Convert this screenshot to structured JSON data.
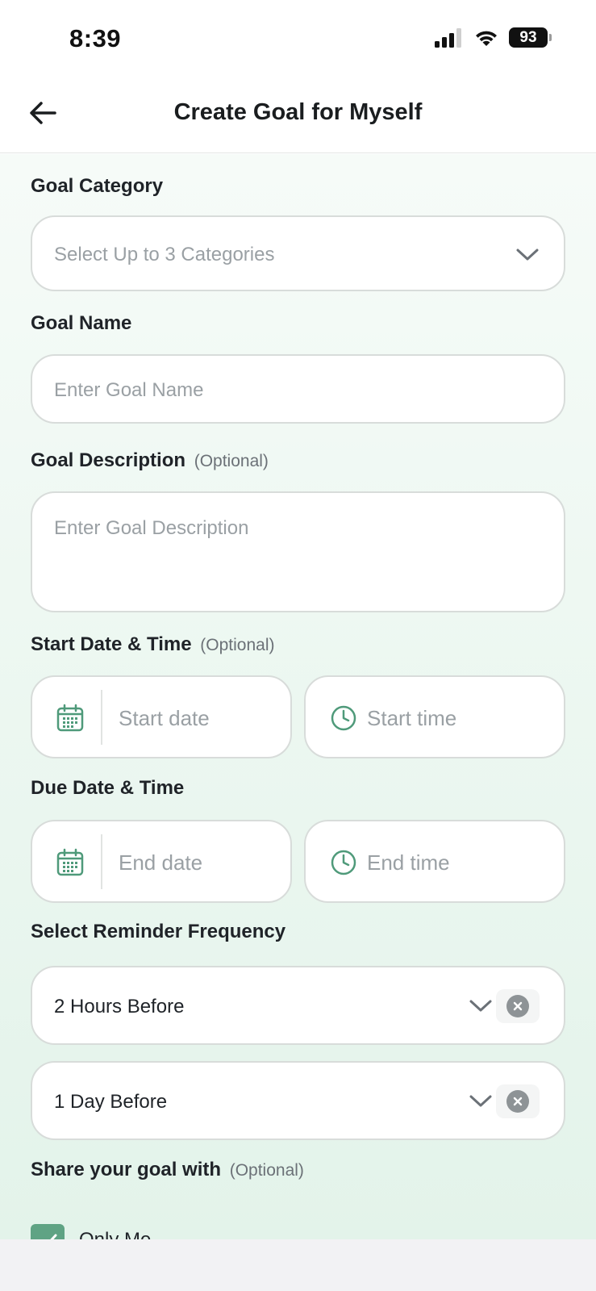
{
  "status_bar": {
    "time": "8:39",
    "battery": "93"
  },
  "header": {
    "title": "Create Goal for Myself"
  },
  "category": {
    "label": "Goal Category",
    "placeholder": "Select Up to 3 Categories"
  },
  "name": {
    "label": "Goal Name",
    "placeholder": "Enter Goal Name"
  },
  "description": {
    "label": "Goal Description",
    "optional": "(Optional)",
    "placeholder": "Enter Goal Description"
  },
  "start": {
    "label": "Start Date & Time",
    "optional": "(Optional)",
    "date_placeholder": "Start date",
    "time_placeholder": "Start time"
  },
  "due": {
    "label": "Due Date & Time",
    "date_placeholder": "End date",
    "time_placeholder": "End time"
  },
  "reminder": {
    "label": "Select Reminder Frequency",
    "values": [
      "2 Hours Before",
      "1 Day Before"
    ]
  },
  "share": {
    "label": "Share your goal with",
    "optional": "(Optional)",
    "option": "Only Me"
  },
  "colors": {
    "accent": "#5fa384",
    "icon": "#4f9a7a",
    "placeholder": "#9aa0a4"
  },
  "icons": [
    "back-arrow-icon",
    "chevron-down-icon",
    "calendar-icon",
    "clock-icon",
    "clear-icon",
    "check-icon"
  ]
}
